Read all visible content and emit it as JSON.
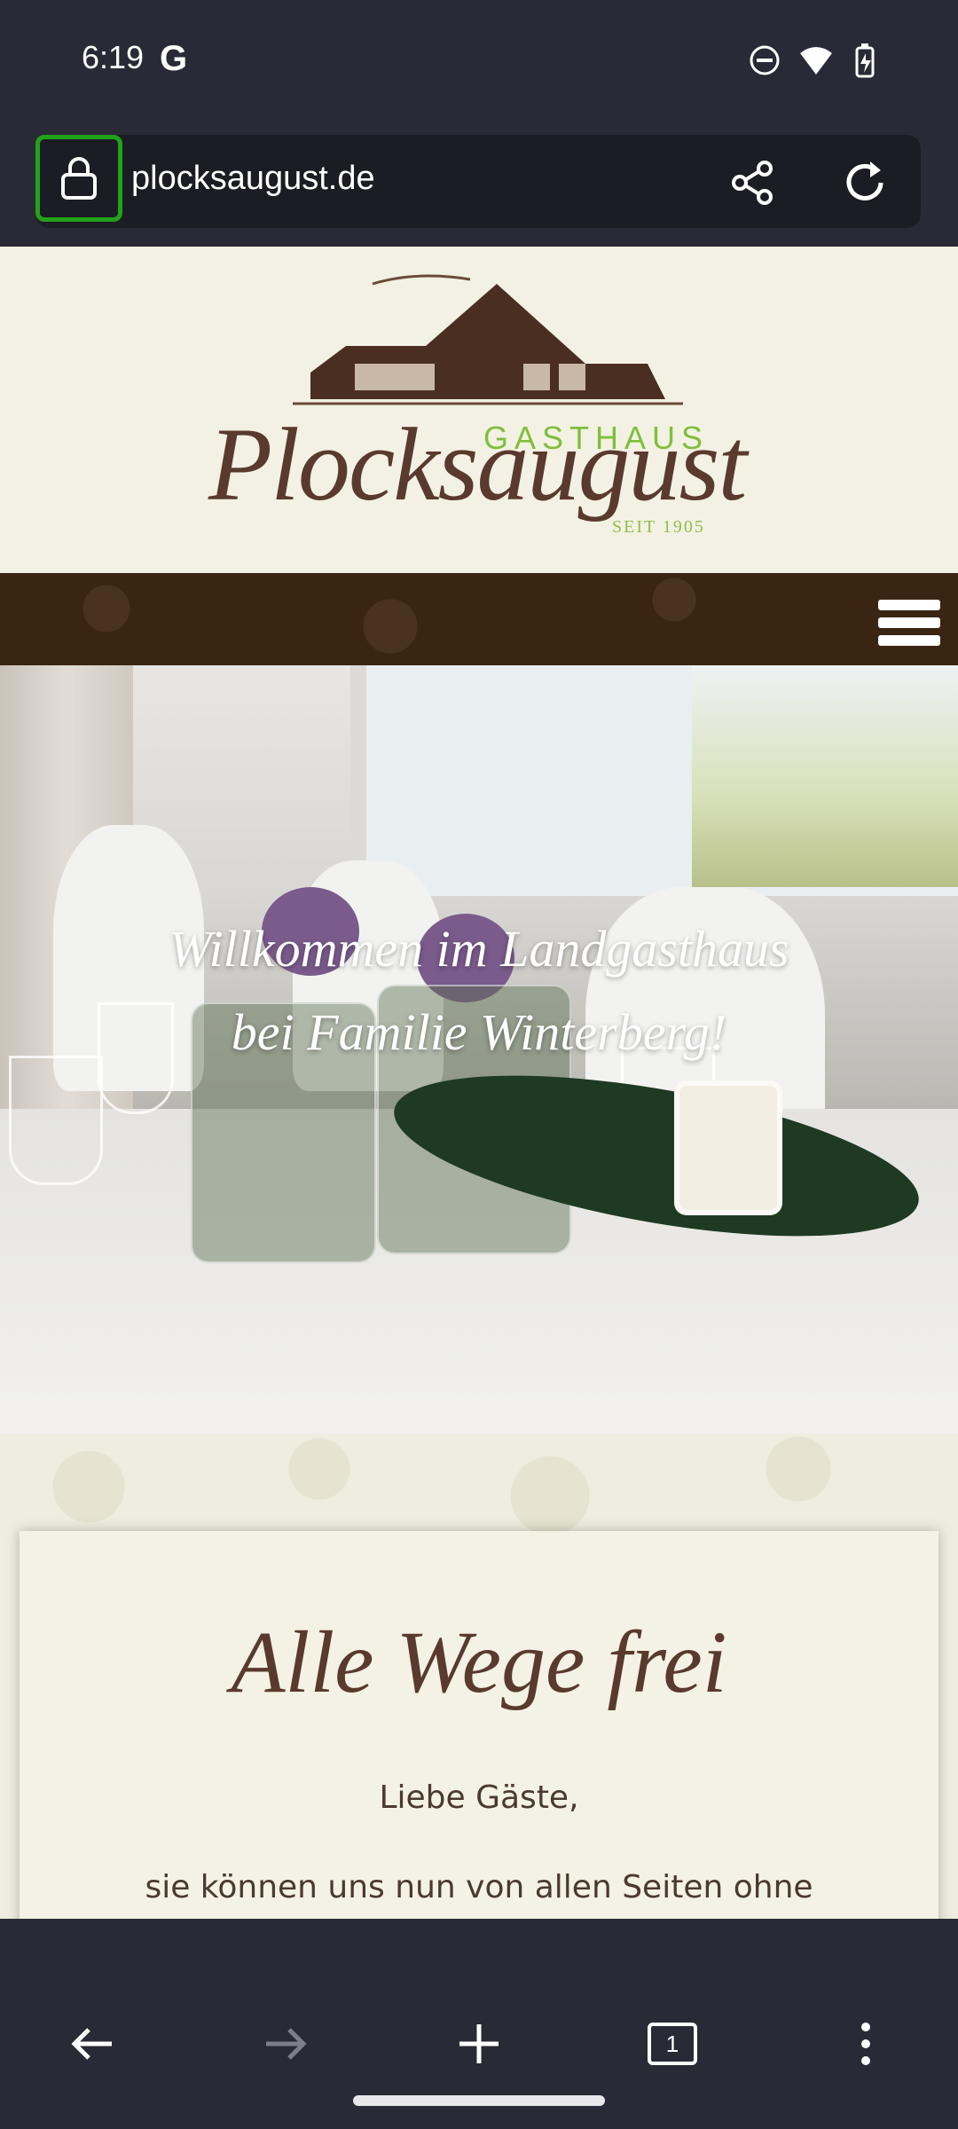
{
  "status_bar": {
    "time": "6:19",
    "google_icon": "G"
  },
  "browser": {
    "url": "plocksaugust.de",
    "lock_icon": "lock-icon",
    "share_icon": "share-icon",
    "reload_icon": "reload-icon"
  },
  "site": {
    "logo": {
      "gasthaus": "GASTHAUS",
      "name": "Plocksaugust",
      "since": "SEIT 1905"
    },
    "hero": {
      "line1": "Willkommen im Landgasthaus",
      "line2": "bei Familie Winterberg!"
    },
    "card": {
      "title": "Alle Wege frei",
      "greeting": "Liebe Gäste,",
      "body": "sie können uns nun von allen Seiten ohne Sperrung anfahren."
    }
  },
  "bottom_nav": {
    "tab_count": "1"
  },
  "colors": {
    "status_bg": "#2a2a36",
    "highlight": "#22a11a",
    "brown": "#5a3a2e",
    "green": "#7fbf3a"
  }
}
